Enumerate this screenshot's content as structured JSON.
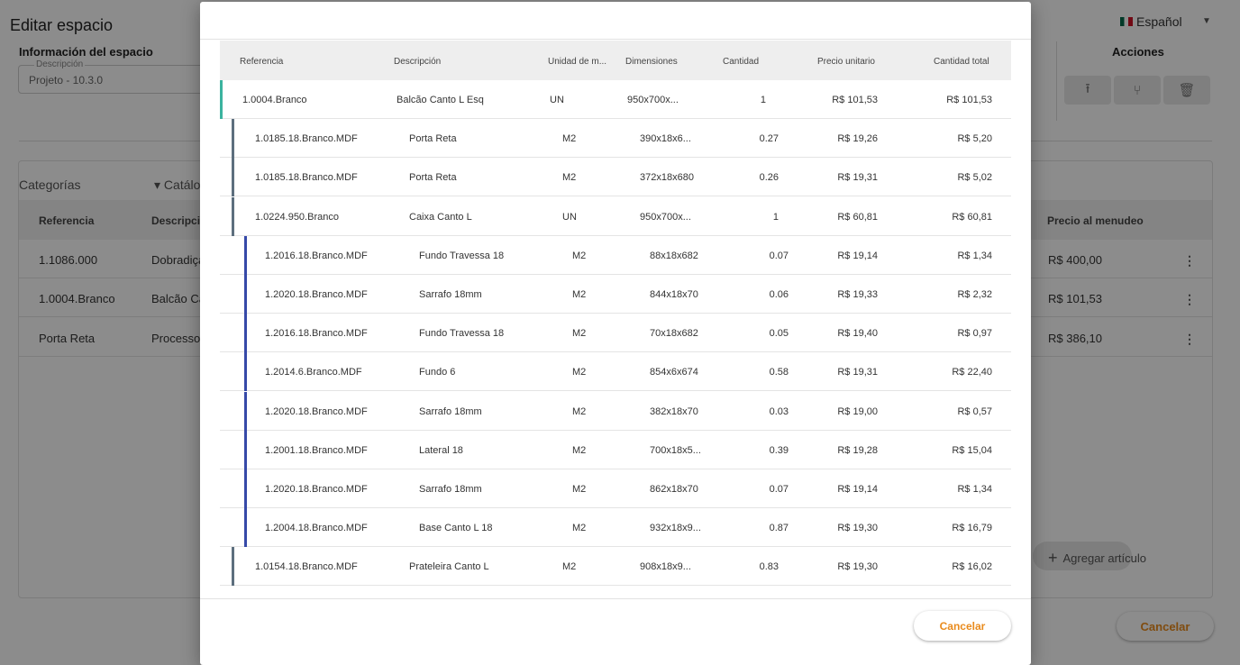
{
  "background": {
    "title": "Editar espacio",
    "language": "Español",
    "info_title": "Información del espacio",
    "description_label": "Descripción",
    "description_value": "Projeto - 10.3.0",
    "actions_title": "Acciones",
    "tabs": {
      "categories": "Categorías",
      "catalog": "Catálo"
    },
    "table_headers": {
      "reference": "Referencia",
      "description": "Descripció",
      "retail_price": "Precio al menudeo"
    },
    "rows": [
      {
        "reference": "1.1086.000",
        "description": "Dobradiça",
        "price": "R$ 400,00"
      },
      {
        "reference": "1.0004.Branco",
        "description": "Balcão Ca",
        "price": "R$ 101,53"
      },
      {
        "reference": "Porta Reta",
        "description": "Processo",
        "price": "R$ 386,10"
      }
    ],
    "add_item": "Agregar artículo",
    "cancel": "Cancelar"
  },
  "modal": {
    "headers": {
      "reference": "Referencia",
      "description": "Descripción",
      "unit": "Unidad de m...",
      "dimensions": "Dimensiones",
      "quantity": "Cantidad",
      "unit_price": "Precio unitario",
      "total_quantity": "Cantidad total"
    },
    "rows": [
      {
        "reference": "1.0004.Branco",
        "description": "Balcão Canto L Esq",
        "unit": "UN",
        "dimensions": "950x700x...",
        "quantity": "1",
        "unit_price": "R$ 101,53",
        "total": "R$ 101,53"
      },
      {
        "reference": "1.0185.18.Branco.MDF",
        "description": "Porta Reta",
        "unit": "M2",
        "dimensions": "390x18x6...",
        "quantity": "0.27",
        "unit_price": "R$ 19,26",
        "total": "R$ 5,20"
      },
      {
        "reference": "1.0185.18.Branco.MDF",
        "description": "Porta Reta",
        "unit": "M2",
        "dimensions": "372x18x680",
        "quantity": "0.26",
        "unit_price": "R$ 19,31",
        "total": "R$ 5,02"
      },
      {
        "reference": "1.0224.950.Branco",
        "description": "Caixa Canto L",
        "unit": "UN",
        "dimensions": "950x700x...",
        "quantity": "1",
        "unit_price": "R$ 60,81",
        "total": "R$ 60,81"
      },
      {
        "reference": "1.2016.18.Branco.MDF",
        "description": "Fundo Travessa 18",
        "unit": "M2",
        "dimensions": "88x18x682",
        "quantity": "0.07",
        "unit_price": "R$ 19,14",
        "total": "R$ 1,34"
      },
      {
        "reference": "1.2020.18.Branco.MDF",
        "description": "Sarrafo 18mm",
        "unit": "M2",
        "dimensions": "844x18x70",
        "quantity": "0.06",
        "unit_price": "R$ 19,33",
        "total": "R$ 2,32"
      },
      {
        "reference": "1.2016.18.Branco.MDF",
        "description": "Fundo Travessa 18",
        "unit": "M2",
        "dimensions": "70x18x682",
        "quantity": "0.05",
        "unit_price": "R$ 19,40",
        "total": "R$ 0,97"
      },
      {
        "reference": "1.2014.6.Branco.MDF",
        "description": "Fundo 6",
        "unit": "M2",
        "dimensions": "854x6x674",
        "quantity": "0.58",
        "unit_price": "R$ 19,31",
        "total": "R$ 22,40"
      },
      {
        "reference": "1.2020.18.Branco.MDF",
        "description": "Sarrafo 18mm",
        "unit": "M2",
        "dimensions": "382x18x70",
        "quantity": "0.03",
        "unit_price": "R$ 19,00",
        "total": "R$ 0,57"
      },
      {
        "reference": "1.2001.18.Branco.MDF",
        "description": "Lateral 18",
        "unit": "M2",
        "dimensions": "700x18x5...",
        "quantity": "0.39",
        "unit_price": "R$ 19,28",
        "total": "R$ 15,04"
      },
      {
        "reference": "1.2020.18.Branco.MDF",
        "description": "Sarrafo 18mm",
        "unit": "M2",
        "dimensions": "862x18x70",
        "quantity": "0.07",
        "unit_price": "R$ 19,14",
        "total": "R$ 1,34"
      },
      {
        "reference": "1.2004.18.Branco.MDF",
        "description": "Base Canto L 18",
        "unit": "M2",
        "dimensions": "932x18x9...",
        "quantity": "0.87",
        "unit_price": "R$ 19,30",
        "total": "R$ 16,79"
      },
      {
        "reference": "1.0154.18.Branco.MDF",
        "description": "Prateleira Canto L",
        "unit": "M2",
        "dimensions": "908x18x9...",
        "quantity": "0.83",
        "unit_price": "R$ 19,30",
        "total": "R$ 16,02"
      }
    ],
    "cancel": "Cancelar"
  },
  "colors": {
    "level0": "#3bb39f",
    "level1": "#5d6f7e",
    "level2": "#3649a8",
    "accent": "#e98b1d"
  }
}
